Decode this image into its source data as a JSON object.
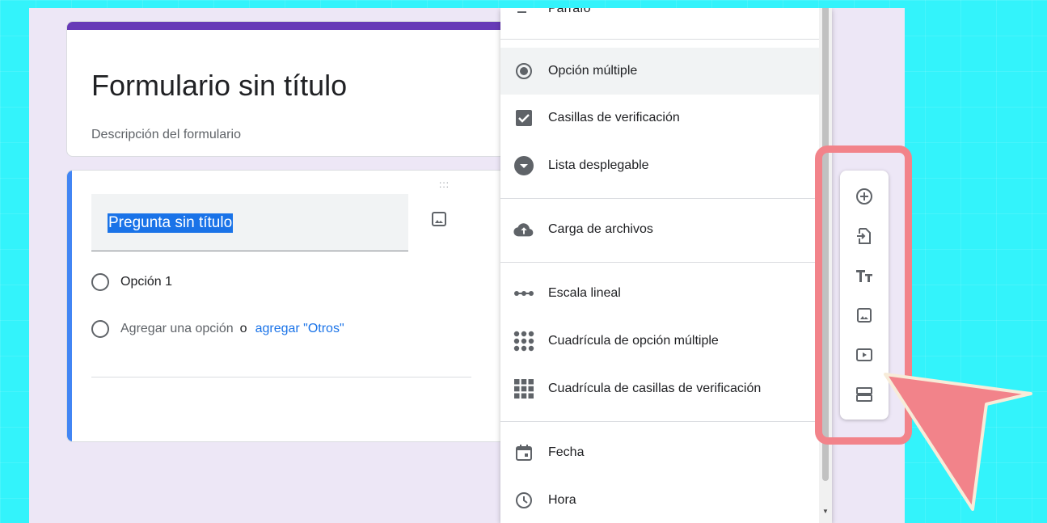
{
  "form": {
    "title": "Formulario sin título",
    "description": "Descripción del formulario"
  },
  "question": {
    "drag_handle": ":::",
    "title": "Pregunta sin título",
    "option1": "Opción 1",
    "add_option": "Agregar una opción",
    "or_word": "o",
    "add_other": "agregar \"Otros\""
  },
  "menu": {
    "items": [
      {
        "label": "Párrafo",
        "icon": "paragraph-icon"
      },
      {
        "label": "Opción múltiple",
        "icon": "radio-icon"
      },
      {
        "label": "Casillas de verificación",
        "icon": "checkbox-icon"
      },
      {
        "label": "Lista desplegable",
        "icon": "dropdown-icon"
      },
      {
        "label": "Carga de archivos",
        "icon": "cloud-upload-icon"
      },
      {
        "label": "Escala lineal",
        "icon": "linear-scale-icon"
      },
      {
        "label": "Cuadrícula de opción múltiple",
        "icon": "radio-grid-icon"
      },
      {
        "label": "Cuadrícula de casillas de verificación",
        "icon": "checkbox-grid-icon"
      },
      {
        "label": "Fecha",
        "icon": "calendar-icon"
      },
      {
        "label": "Hora",
        "icon": "clock-icon"
      }
    ]
  },
  "toolbar": {
    "tools": [
      "add-question-icon",
      "import-questions-icon",
      "add-title-icon",
      "add-image-icon",
      "add-video-icon",
      "add-section-icon"
    ]
  },
  "colors": {
    "background": "#33f3fb",
    "form_accent": "#673ab7",
    "question_accent": "#4285f4",
    "link": "#1a73e8",
    "highlight": "#f2838a"
  }
}
